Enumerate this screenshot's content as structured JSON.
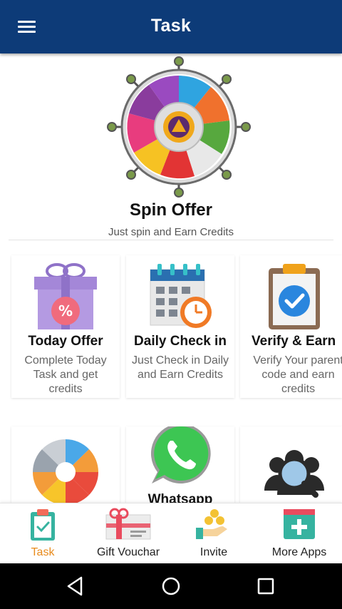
{
  "appbar": {
    "title": "Task",
    "menu_icon": "hamburger-menu-icon"
  },
  "spin": {
    "title": "Spin Offer",
    "subtitle": "Just spin and Earn Credits",
    "icon": "spin-wheel-icon"
  },
  "cards": [
    {
      "title": "Today Offer",
      "desc": "Complete Today Task and get credits",
      "icon": "gift-box-icon"
    },
    {
      "title": "Daily Check in",
      "desc": "Just Check in Daily and Earn Credits",
      "icon": "calendar-clock-icon"
    },
    {
      "title": "Verify & Earn",
      "desc": "Verify Your parent code and earn credits",
      "icon": "clipboard-check-icon"
    },
    {
      "title": "",
      "desc": "",
      "icon": "color-wheel-icon"
    },
    {
      "title": "Whatsapp",
      "desc": "",
      "icon": "whatsapp-icon"
    },
    {
      "title": "",
      "desc": "",
      "icon": "user-search-icon"
    }
  ],
  "bottom_nav": [
    {
      "label": "Task",
      "active": true,
      "icon": "task-clipboard-icon"
    },
    {
      "label": "Gift Vouchar",
      "active": false,
      "icon": "gift-voucher-icon"
    },
    {
      "label": "Invite",
      "active": false,
      "icon": "invite-coins-icon"
    },
    {
      "label": "More Apps",
      "active": false,
      "icon": "more-apps-icon"
    }
  ],
  "colors": {
    "appbar": "#0d3b78",
    "active_tab": "#e88b1d"
  },
  "system_nav": [
    "back-icon",
    "home-icon",
    "recents-icon"
  ]
}
